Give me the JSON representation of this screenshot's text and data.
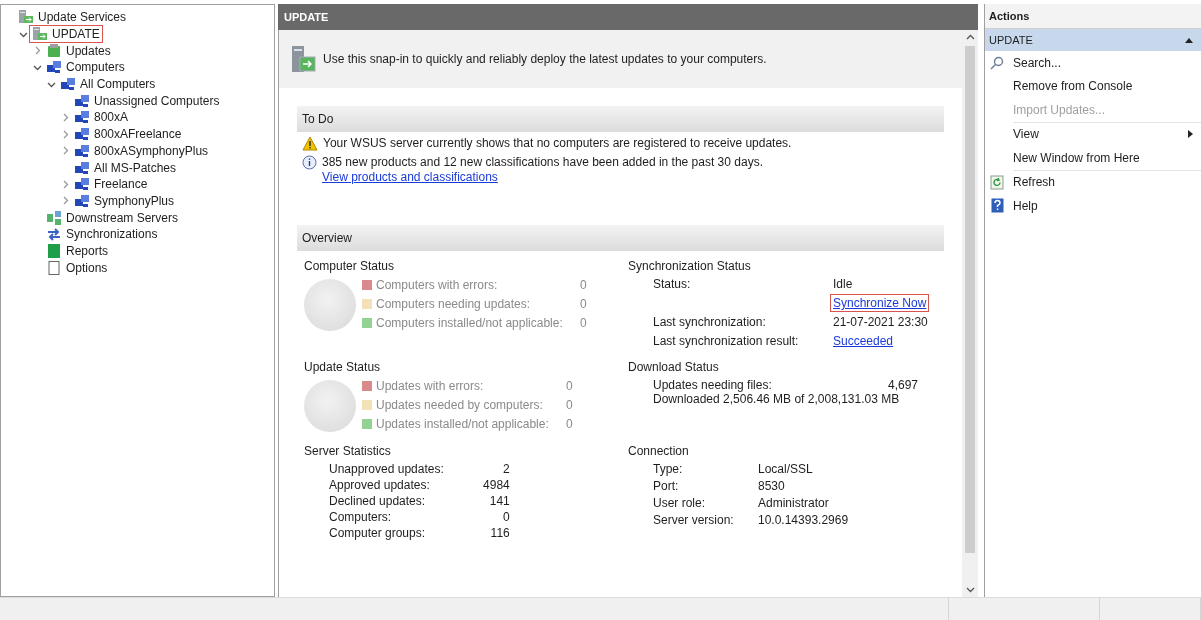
{
  "tree": [
    {
      "label": "Update Services",
      "kind": "server",
      "children": [
        {
          "label": "UPDATE",
          "kind": "server",
          "expanded": true,
          "highlighted": true,
          "children": [
            {
              "label": "Updates",
              "kind": "updates",
              "expanded": false,
              "highlighted": false
            },
            {
              "label": "Computers",
              "kind": "computers",
              "expanded": true,
              "highlighted": false,
              "children": [
                {
                  "label": "All Computers",
                  "kind": "computers",
                  "expanded": true,
                  "highlighted": false,
                  "children": [
                    {
                      "label": "Unassigned Computers",
                      "kind": "computers",
                      "highlighted": false
                    },
                    {
                      "label": "800xA",
                      "kind": "computers",
                      "expanded": false,
                      "highlighted": false
                    },
                    {
                      "label": "800xAFreelance",
                      "kind": "computers",
                      "expanded": false,
                      "highlighted": false
                    },
                    {
                      "label": "800xASymphonyPlus",
                      "kind": "computers",
                      "expanded": false,
                      "highlighted": false
                    },
                    {
                      "label": "All MS-Patches",
                      "kind": "computers",
                      "highlighted": false
                    },
                    {
                      "label": "Freelance",
                      "kind": "computers",
                      "expanded": false,
                      "highlighted": false
                    },
                    {
                      "label": "SymphonyPlus",
                      "kind": "computers",
                      "expanded": false,
                      "highlighted": false
                    }
                  ]
                }
              ]
            },
            {
              "label": "Downstream Servers",
              "kind": "downstream",
              "highlighted": false
            },
            {
              "label": "Synchronizations",
              "kind": "sync",
              "highlighted": false
            },
            {
              "label": "Reports",
              "kind": "reports",
              "highlighted": false
            },
            {
              "label": "Options",
              "kind": "options",
              "highlighted": false
            }
          ]
        }
      ],
      "highlighted": false
    }
  ],
  "center": {
    "title": "UPDATE",
    "intro": "Use this snap-in to quickly and reliably deploy the latest updates to your computers.",
    "todo": {
      "title": "To Do",
      "messages": [
        {
          "kind": "warning",
          "text": "Your WSUS server currently shows that no computers are registered to receive updates."
        },
        {
          "kind": "info",
          "text": "385 new products and 12 new classifications have been added in the past 30 days.",
          "link": "View products and classifications"
        }
      ]
    },
    "overview": {
      "title": "Overview",
      "computer_status": {
        "title": "Computer Status",
        "legend": [
          {
            "label": "Computers with errors:",
            "value": "0",
            "color": "#d98a8c"
          },
          {
            "label": "Computers needing updates:",
            "value": "0",
            "color": "#f3e2b5"
          },
          {
            "label": "Computers installed/not applicable:",
            "value": "0",
            "color": "#93d293"
          }
        ]
      },
      "synchronization_status": {
        "title": "Synchronization Status",
        "rows": [
          {
            "label": "Status:",
            "value": "Idle",
            "kind": "text",
            "highlighted": false
          },
          {
            "value": "Synchronize Now",
            "kind": "link",
            "highlighted": true
          },
          {
            "label": "Last synchronization:",
            "value": "21-07-2021 23:30",
            "kind": "text",
            "highlighted": false
          },
          {
            "label": "Last synchronization result:",
            "value": "Succeeded",
            "kind": "link",
            "highlighted": false
          }
        ]
      },
      "update_status": {
        "title": "Update Status",
        "legend": [
          {
            "label": "Updates with errors:",
            "value": "0",
            "color": "#d98a8c"
          },
          {
            "label": "Updates needed by computers:",
            "value": "0",
            "color": "#f3e2b5"
          },
          {
            "label": "Updates installed/not applicable:",
            "value": "0",
            "color": "#93d293"
          }
        ]
      },
      "download_status": {
        "title": "Download Status",
        "needing_label": "Updates needing files:",
        "needing_value": "4,697",
        "downloaded": "Downloaded 2,506.46 MB of 2,008,131.03 MB"
      },
      "server_statistics": {
        "title": "Server Statistics",
        "rows": [
          {
            "label": "Unapproved updates:",
            "value": "2"
          },
          {
            "label": "Approved updates:",
            "value": "4984"
          },
          {
            "label": "Declined updates:",
            "value": "141"
          },
          {
            "label": "Computers:",
            "value": "0"
          },
          {
            "label": "Computer groups:",
            "value": "116"
          }
        ]
      },
      "connection": {
        "title": "Connection",
        "rows": [
          {
            "label": "Type:",
            "value": "Local/SSL"
          },
          {
            "label": "Port:",
            "value": "8530"
          },
          {
            "label": "User role:",
            "value": "Administrator"
          },
          {
            "label": "Server version:",
            "value": "10.0.14393.2969"
          }
        ]
      }
    }
  },
  "actions": {
    "title": "Actions",
    "group": {
      "label": "UPDATE",
      "expanded": true
    },
    "items": [
      {
        "label": "Search...",
        "kind": "search",
        "disabled": false,
        "separator_after": false
      },
      {
        "label": "Remove from Console",
        "kind": "plain",
        "disabled": false,
        "separator_after": false
      },
      {
        "label": "Import Updates...",
        "kind": "plain",
        "disabled": true,
        "separator_after": true
      },
      {
        "label": "View",
        "kind": "submenu",
        "disabled": false,
        "separator_after": false
      },
      {
        "label": "New Window from Here",
        "kind": "plain",
        "disabled": false,
        "separator_after": true
      },
      {
        "label": "Refresh",
        "kind": "refresh",
        "disabled": false,
        "separator_after": false
      },
      {
        "label": "Help",
        "kind": "help",
        "disabled": false,
        "separator_after": false
      }
    ]
  }
}
